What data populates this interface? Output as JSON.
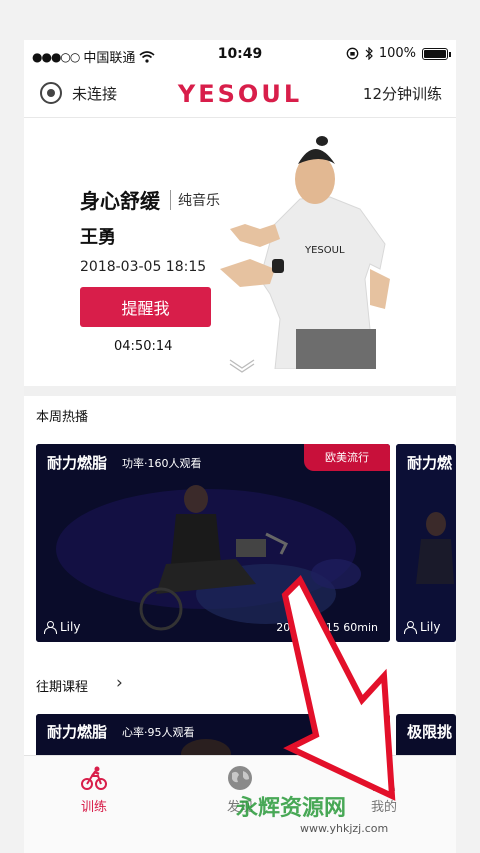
{
  "status_bar": {
    "carrier": "中国联通",
    "time": "10:49",
    "battery": "100%",
    "signal_icon": "signal-dots-icon",
    "wifi_icon": "wifi-icon",
    "bluetooth_icon": "bluetooth-icon"
  },
  "header": {
    "connection_label": "未连接",
    "logo": "YESOUL",
    "right_label": "12分钟训练"
  },
  "hero": {
    "title": "身心舒缓",
    "tag": "纯音乐",
    "coach": "王勇",
    "date": "2018-03-05  18:15",
    "button": "提醒我",
    "countdown": "04:50:14"
  },
  "hot_section": {
    "title": "本周热播",
    "cards": [
      {
        "title": "耐力燃脂",
        "meta": "功率·160人观看",
        "tag": "欧美流行",
        "coach": "Lily",
        "info": "2018-02    15 60min"
      },
      {
        "title": "耐力燃",
        "coach": "Lily"
      }
    ]
  },
  "past_section": {
    "title": "往期课程",
    "cards": [
      {
        "title": "耐力燃脂",
        "meta": "心率·95人观看"
      },
      {
        "title": "极限挑"
      }
    ]
  },
  "tabbar": {
    "items": [
      {
        "label": "训练",
        "icon": "cycling-icon",
        "active": true
      },
      {
        "label": "发现",
        "icon": "globe-icon",
        "active": false
      },
      {
        "label": "我的",
        "icon": "user-icon",
        "active": false
      }
    ]
  },
  "watermark": {
    "text": "永辉资源网",
    "url": "www.yhkjzj.com"
  },
  "colors": {
    "accent": "#d81e4a",
    "card_bg": "#0a0c2a",
    "tag_red": "#c8103a",
    "arrow_red": "#e3102a"
  }
}
